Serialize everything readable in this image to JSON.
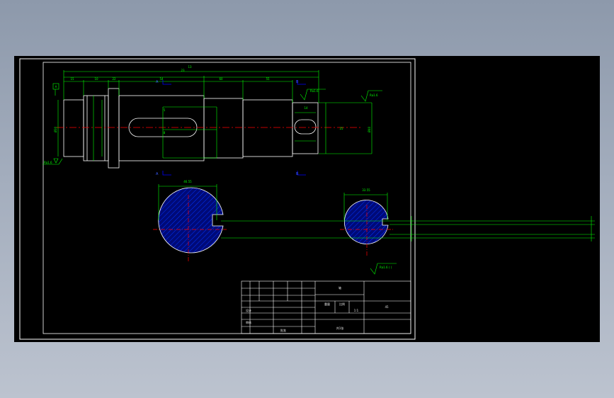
{
  "drawing": {
    "colors": {
      "background": "#000000",
      "outline": "#ffffff",
      "dimension": "#00ff00",
      "centerline": "#ff0000",
      "section_callout": "#0000ff",
      "hatch": "#0033ff",
      "section_fill": "#000a78"
    },
    "dimensions": {
      "overall_length": "13",
      "dim_a": "23",
      "dim_b": "15",
      "dim_c": "10",
      "dim_d": "22",
      "dim_e": "54",
      "dim_f": "60",
      "dim_g": "55",
      "dim_h": "14",
      "slot_a": "5",
      "slot_b": "8",
      "right_dim": "25",
      "dia_a": "Ø30",
      "dia_b": "Ø40",
      "section_a_width": "46.55",
      "section_b_width": "33.55",
      "roughness_a": "Ra1.6",
      "roughness_b": "Ra1.6",
      "roughness_c": "Ra1.6",
      "roughness_d": "Ra1.6",
      "roughness_note": "Ra1.6 ( )",
      "datum": "A"
    },
    "sections": {
      "a_label": "A",
      "b_label": "B"
    },
    "title_block": {
      "title": "轴",
      "drawing_no": "",
      "scale_label": "比例",
      "scale_value": "1:1",
      "material": "45",
      "designer": "设计",
      "checker": "审核",
      "approver": "批准",
      "weight": "重量",
      "sheet": "共1张"
    }
  }
}
